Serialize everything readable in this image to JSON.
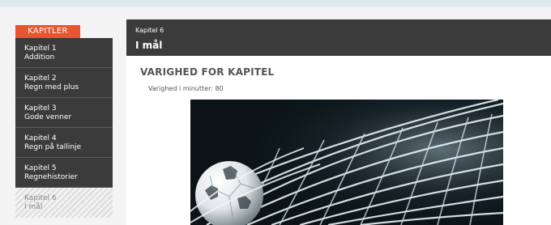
{
  "sidebar": {
    "heading": "KAPITLER",
    "chapters": [
      {
        "number": "Kapitel 1",
        "name": "Addition"
      },
      {
        "number": "Kapitel 2",
        "name": "Regn med plus"
      },
      {
        "number": "Kapitel 3",
        "name": "Gode venner"
      },
      {
        "number": "Kapitel 4",
        "name": "Regn på tallinje"
      },
      {
        "number": "Kapitel 5",
        "name": "Regnehistorier"
      },
      {
        "number": "Kapitel 6",
        "name": "I mål"
      }
    ]
  },
  "header": {
    "chapter_label": "Kapitel 6",
    "title": "I mål"
  },
  "main": {
    "section_title": "VARIGHED FOR KAPITEL",
    "duration_text": "Varighed i minutter: 80",
    "image": "soccer-ball-in-goal-net-photo"
  },
  "colors": {
    "accent": "#e8552f",
    "dark": "#3b3b3b",
    "background": "#dfe9ee"
  }
}
